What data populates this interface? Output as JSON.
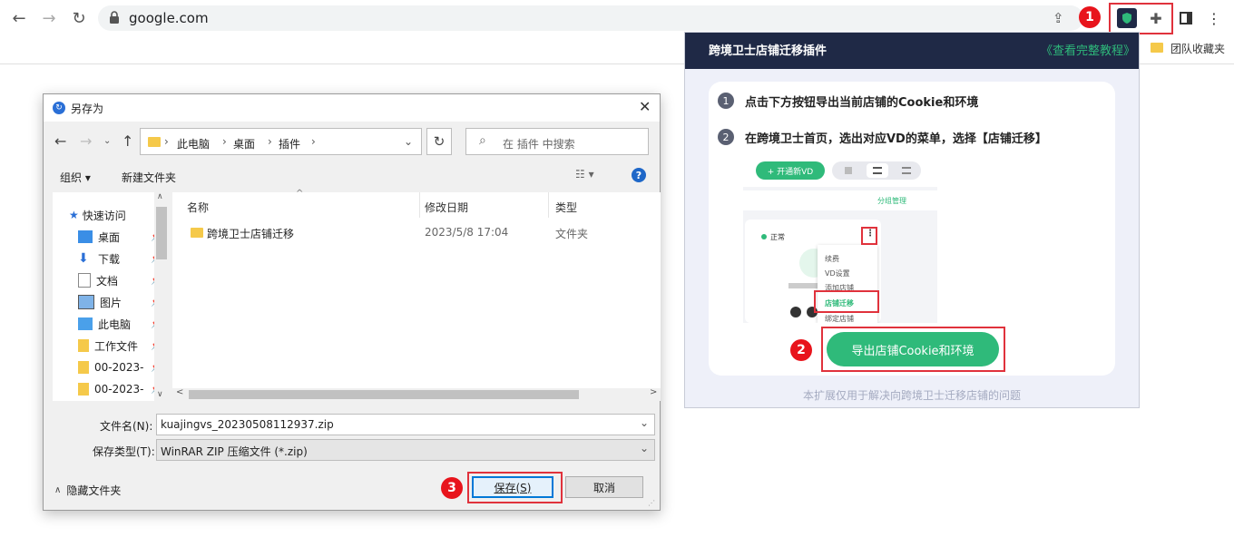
{
  "browser": {
    "url": "google.com",
    "bookmark_folder": "团队收藏夹"
  },
  "annotations": {
    "badge1": "1",
    "badge2": "2",
    "badge3": "3",
    "color": "#e8141c"
  },
  "extension_popup": {
    "title": "跨境卫士店铺迁移插件",
    "tutorial_link": "《查看完整教程》",
    "step1_num": "1",
    "step1_text": "点击下方按钮导出当前店铺的Cookie和环境",
    "step2_num": "2",
    "step2_text": "在跨境卫士首页，选出对应VD的菜单，选择【店铺迁移】",
    "export_button": "导出店铺Cookie和环境",
    "footer": "本扩展仅用于解决向跨境卫士迁移店铺的问题",
    "accent_color": "#2fba7a",
    "mini": {
      "new_vd_button": "+ 开通新VD",
      "group_manage": "分组管理",
      "status": "正常",
      "menu_items": [
        "续费",
        "VD设置",
        "添加店铺",
        "店铺迁移",
        "绑定店铺"
      ]
    }
  },
  "dialog": {
    "title": "另存为",
    "breadcrumb": [
      "此电脑",
      "桌面",
      "插件"
    ],
    "search_placeholder": "在 插件 中搜索",
    "organize": "组织 ▾",
    "new_folder": "新建文件夹",
    "nav": {
      "quick_access": "快速访问",
      "items": [
        "桌面",
        "下载",
        "文档",
        "图片",
        "此电脑",
        "工作文件",
        "00-2023-",
        "00-2023-"
      ]
    },
    "columns": {
      "name": "名称",
      "modified": "修改日期",
      "type": "类型"
    },
    "files": [
      {
        "name": "跨境卫士店铺迁移",
        "modified": "2023/5/8 17:04",
        "type": "文件夹"
      }
    ],
    "filename_label": "文件名(N):",
    "filename_value": "kuajingvs_20230508112937.zip",
    "filetype_label": "保存类型(T):",
    "filetype_value": "WinRAR ZIP 压缩文件 (*.zip)",
    "hide_folders": "隐藏文件夹",
    "save_button": "保存(S)",
    "cancel_button": "取消"
  }
}
